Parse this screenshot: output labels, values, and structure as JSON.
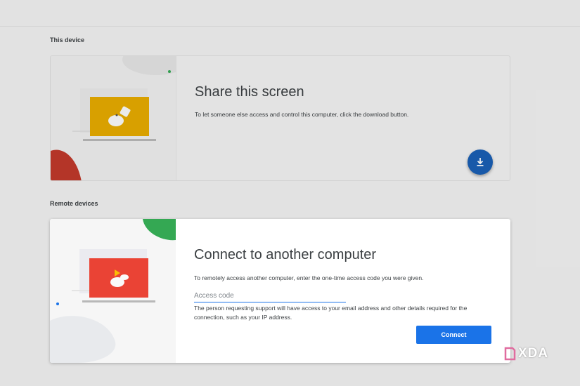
{
  "sections": {
    "this_device": "This device",
    "remote_devices": "Remote devices"
  },
  "share_card": {
    "title": "Share this screen",
    "description": "To let someone else access and control this computer, click the download button.",
    "download_icon": "download-icon"
  },
  "connect_card": {
    "title": "Connect to another computer",
    "description": "To remotely access another computer, enter the one-time access code you were given.",
    "access_code_placeholder": "Access code",
    "note": "The person requesting support will have access to your email address and other details required for the connection, such as your IP address.",
    "connect_label": "Connect"
  },
  "watermark": {
    "text": "XDA"
  },
  "colors": {
    "primary": "#1a73e8",
    "fab": "#1a5fb4",
    "share_laptop": "#f4b400",
    "connect_laptop": "#ea4335",
    "green_accent": "#34a853",
    "red_accent": "#d93025"
  }
}
